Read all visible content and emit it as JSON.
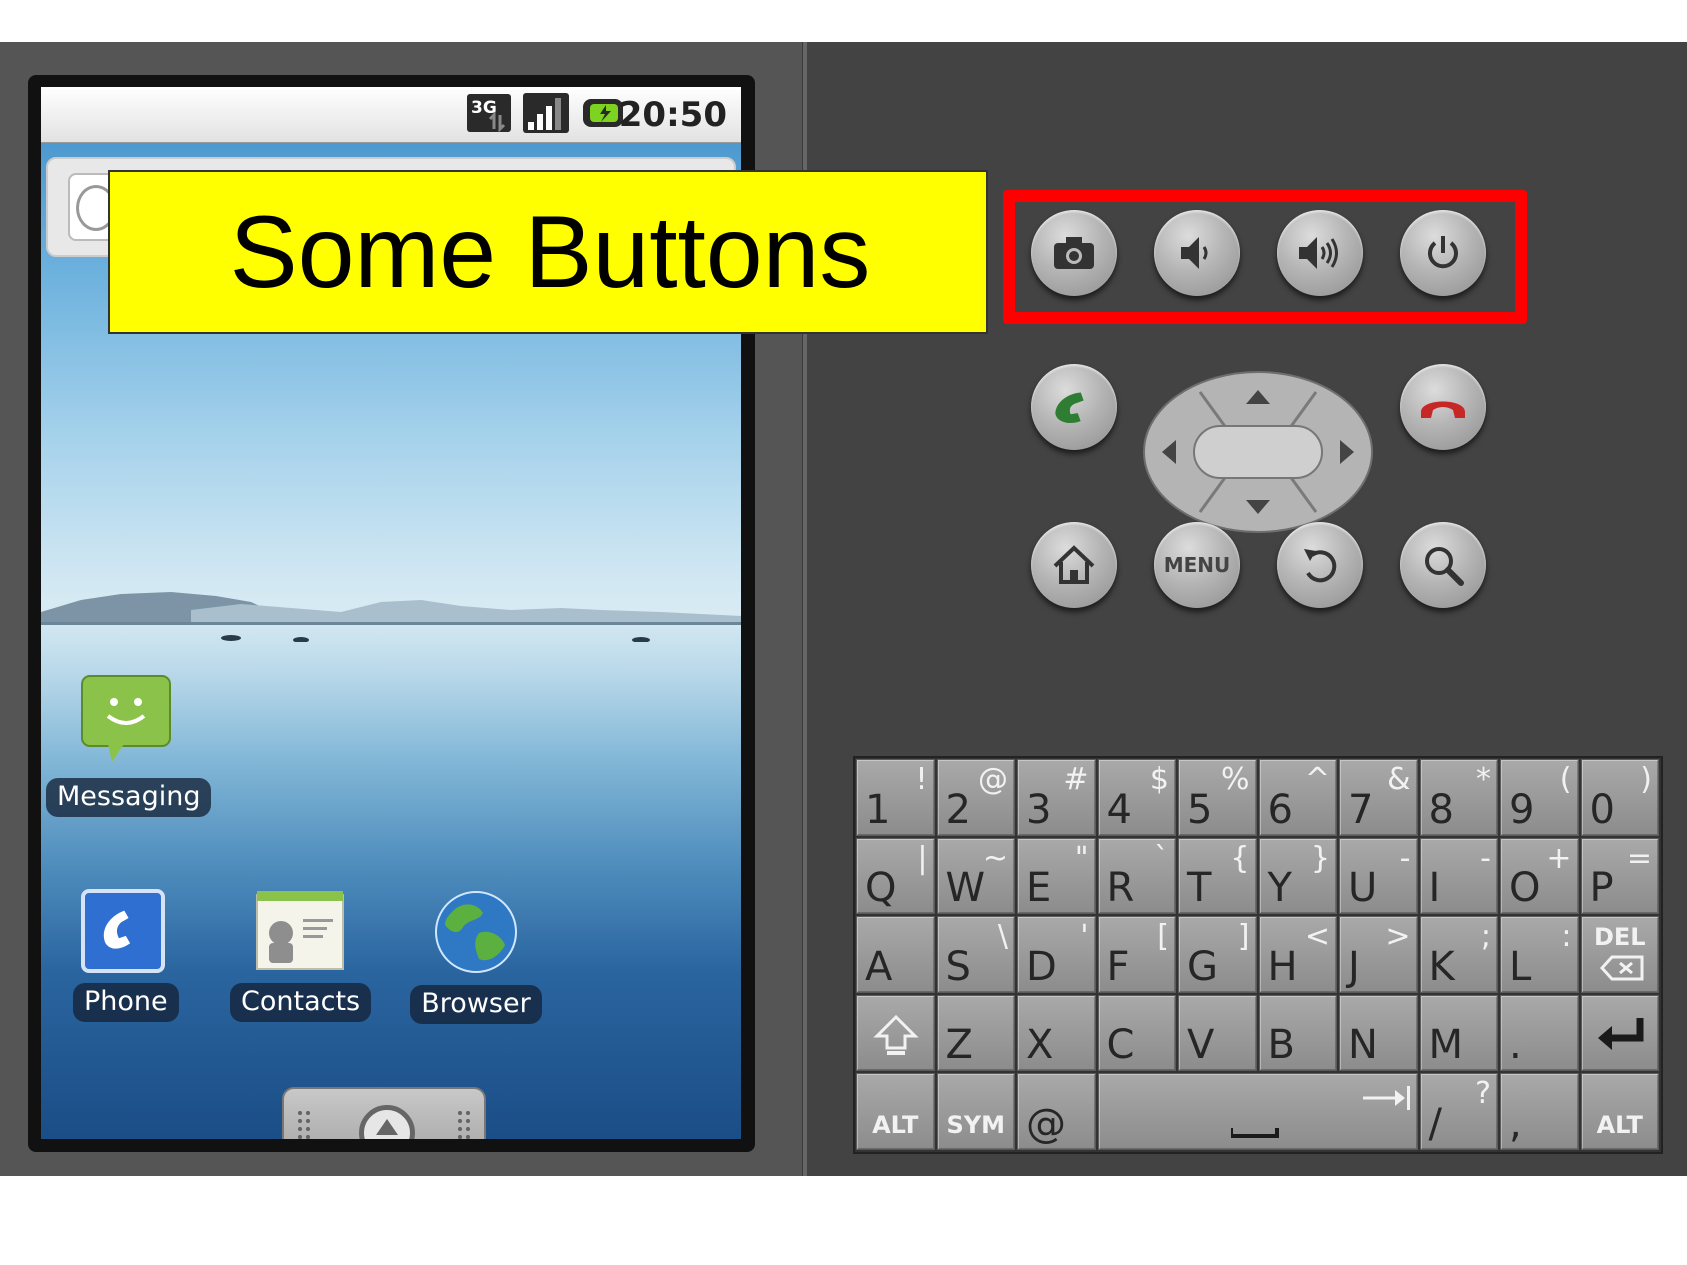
{
  "status_bar": {
    "time": "20:50",
    "network_badge": "3G"
  },
  "apps": {
    "messaging": "Messaging",
    "phone": "Phone",
    "contacts": "Contacts",
    "browser": "Browser"
  },
  "callout": {
    "text": "Some Buttons"
  },
  "hardware_buttons": {
    "top_row": [
      "camera-icon",
      "volume-down-icon",
      "volume-up-icon",
      "power-icon"
    ],
    "nav_row": [
      "call-icon",
      "dpad",
      "end-call-icon"
    ],
    "bottom_row": [
      "home-icon",
      "menu",
      "back-icon",
      "search-icon"
    ],
    "menu_label": "MENU"
  },
  "colors": {
    "highlight": "#ff0000",
    "callout": "#ffff00",
    "call": "#2e7d32",
    "end_call": "#c62828"
  },
  "keyboard": {
    "row1": [
      {
        "main": "1",
        "alt": "!"
      },
      {
        "main": "2",
        "alt": "@"
      },
      {
        "main": "3",
        "alt": "#"
      },
      {
        "main": "4",
        "alt": "$"
      },
      {
        "main": "5",
        "alt": "%"
      },
      {
        "main": "6",
        "alt": "^"
      },
      {
        "main": "7",
        "alt": "&"
      },
      {
        "main": "8",
        "alt": "*"
      },
      {
        "main": "9",
        "alt": "("
      },
      {
        "main": "0",
        "alt": ")"
      }
    ],
    "row2": [
      {
        "main": "Q",
        "alt": "|"
      },
      {
        "main": "W",
        "alt": "~"
      },
      {
        "main": "E",
        "alt": "\""
      },
      {
        "main": "R",
        "alt": "`"
      },
      {
        "main": "T",
        "alt": "{"
      },
      {
        "main": "Y",
        "alt": "}"
      },
      {
        "main": "U",
        "alt": "-"
      },
      {
        "main": "I",
        "alt": "-"
      },
      {
        "main": "O",
        "alt": "+"
      },
      {
        "main": "P",
        "alt": "="
      }
    ],
    "row3": [
      {
        "main": "A",
        "alt": ""
      },
      {
        "main": "S",
        "alt": "\\"
      },
      {
        "main": "D",
        "alt": "'"
      },
      {
        "main": "F",
        "alt": "["
      },
      {
        "main": "G",
        "alt": "]"
      },
      {
        "main": "H",
        "alt": "<"
      },
      {
        "main": "J",
        "alt": ">"
      },
      {
        "main": "K",
        "alt": ";"
      },
      {
        "main": "L",
        "alt": ":"
      }
    ],
    "del_label": "DEL",
    "row4": [
      {
        "main": "Z",
        "alt": ""
      },
      {
        "main": "X",
        "alt": ""
      },
      {
        "main": "C",
        "alt": ""
      },
      {
        "main": "V",
        "alt": ""
      },
      {
        "main": "B",
        "alt": ""
      },
      {
        "main": "N",
        "alt": ""
      },
      {
        "main": "M",
        "alt": ""
      },
      {
        "main": ".",
        "alt": ""
      }
    ],
    "row5": {
      "alt_left": "ALT",
      "sym": "SYM",
      "at": "@",
      "slash": "/",
      "slash_alt": "?",
      "comma": ",",
      "alt_right": "ALT"
    }
  }
}
